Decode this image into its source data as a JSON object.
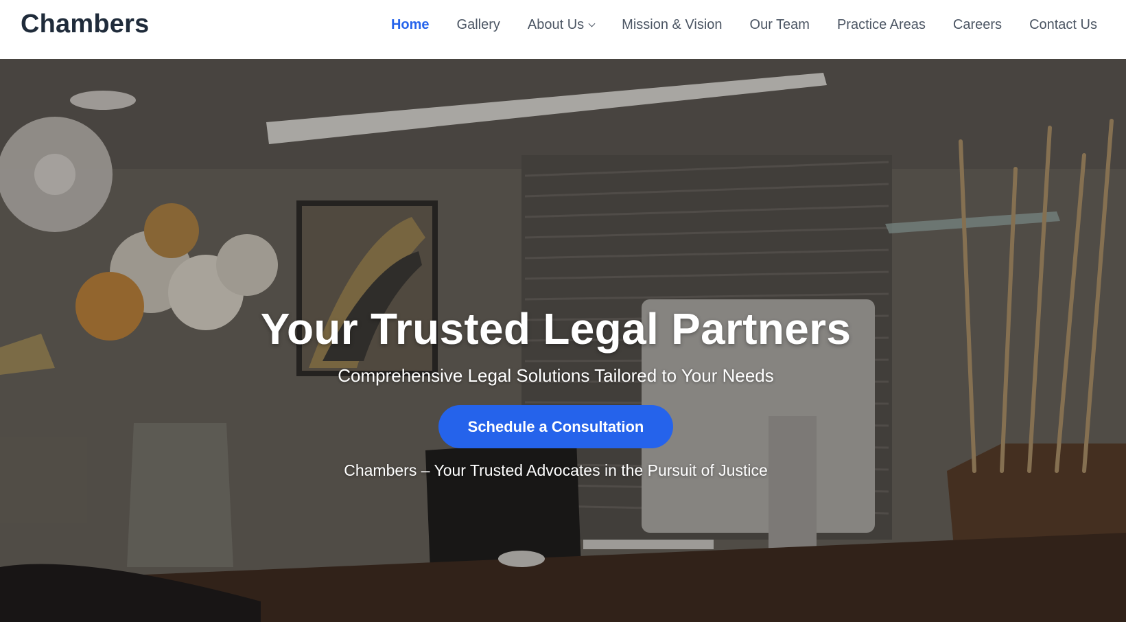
{
  "header": {
    "brand": "Chambers",
    "nav": [
      {
        "label": "Home",
        "active": true
      },
      {
        "label": "Gallery"
      },
      {
        "label": "About Us",
        "has_dropdown": true
      },
      {
        "label": "Mission & Vision"
      },
      {
        "label": "Our Team"
      },
      {
        "label": "Practice Areas"
      },
      {
        "label": "Careers"
      },
      {
        "label": "Contact Us"
      }
    ]
  },
  "hero": {
    "title": "Your Trusted Legal Partners",
    "subtitle": "Comprehensive Legal Solutions Tailored to Your Needs",
    "cta_label": "Schedule a Consultation",
    "tagline": "Chambers – Your Trusted Advocates in the Pursuit of Justice",
    "background_icon": "office-photo"
  },
  "colors": {
    "accent": "#2563eb",
    "brand_text": "#1f2b3a",
    "nav_text": "#4b5563"
  }
}
